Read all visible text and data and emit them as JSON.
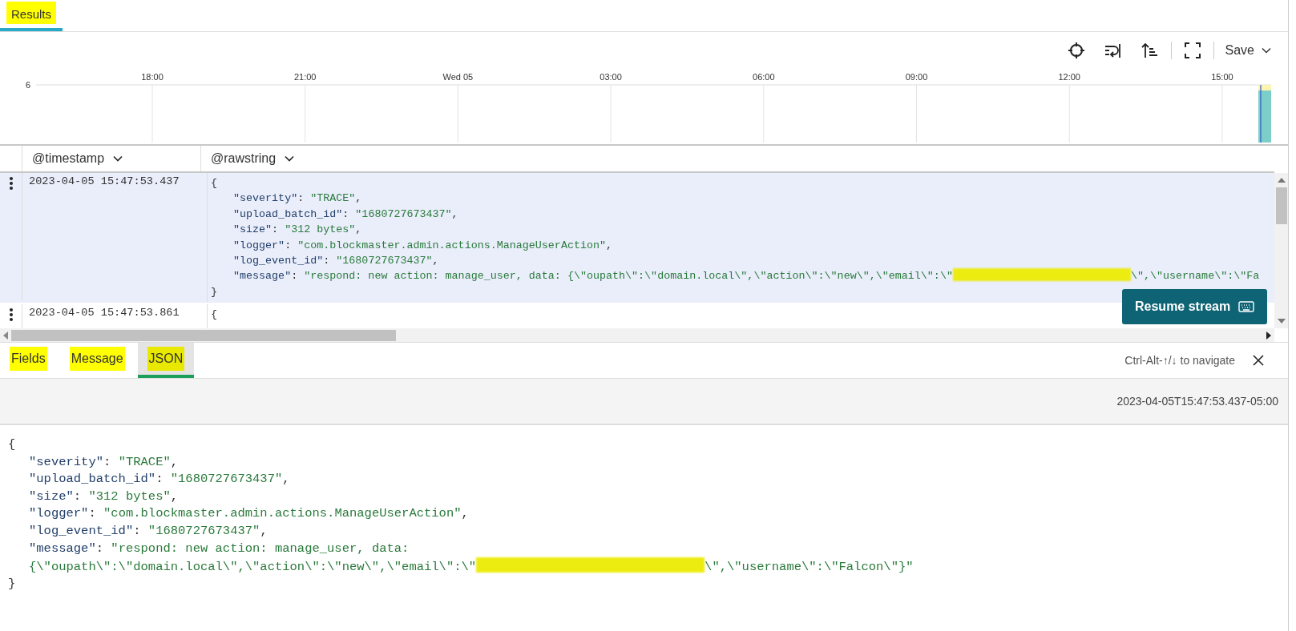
{
  "results_tab": {
    "label": "Results",
    "selected": true,
    "highlighted": true
  },
  "toolbar": {
    "save_label": "Save"
  },
  "histogram": {
    "y_label": "6",
    "x_labels": [
      "18:00",
      "21:00",
      "Wed 05",
      "03:00",
      "06:00",
      "09:00",
      "12:00",
      "15:00"
    ]
  },
  "table": {
    "columns": [
      {
        "label": "@timestamp"
      },
      {
        "label": "@rawstring"
      }
    ],
    "rows": [
      {
        "selected": true,
        "timestamp": "2023-04-05 15:47:53.437",
        "lines": [
          {
            "kind": "brace",
            "segments": [
              {
                "kind": "punct",
                "text": "{"
              }
            ]
          },
          {
            "kind": "field",
            "segments": [
              {
                "kind": "key",
                "text": "\"severity\""
              },
              {
                "kind": "punct",
                "text": ": "
              },
              {
                "kind": "string",
                "text": "\"TRACE\""
              },
              {
                "kind": "punct",
                "text": ","
              }
            ]
          },
          {
            "kind": "field",
            "segments": [
              {
                "kind": "key",
                "text": "\"upload_batch_id\""
              },
              {
                "kind": "punct",
                "text": ": "
              },
              {
                "kind": "string",
                "text": "\"1680727673437\""
              },
              {
                "kind": "punct",
                "text": ","
              }
            ]
          },
          {
            "kind": "field",
            "segments": [
              {
                "kind": "key",
                "text": "\"size\""
              },
              {
                "kind": "punct",
                "text": ": "
              },
              {
                "kind": "string",
                "text": "\"312 bytes\""
              },
              {
                "kind": "punct",
                "text": ","
              }
            ]
          },
          {
            "kind": "field",
            "segments": [
              {
                "kind": "key",
                "text": "\"logger\""
              },
              {
                "kind": "punct",
                "text": ": "
              },
              {
                "kind": "string",
                "text": "\"com.blockmaster.admin.actions.ManageUserAction\""
              },
              {
                "kind": "punct",
                "text": ","
              }
            ]
          },
          {
            "kind": "field",
            "segments": [
              {
                "kind": "key",
                "text": "\"log_event_id\""
              },
              {
                "kind": "punct",
                "text": ": "
              },
              {
                "kind": "string",
                "text": "\"1680727673437\""
              },
              {
                "kind": "punct",
                "text": ","
              }
            ]
          },
          {
            "kind": "field",
            "segments": [
              {
                "kind": "key",
                "text": "\"message\""
              },
              {
                "kind": "punct",
                "text": ": "
              },
              {
                "kind": "string",
                "text": "\"respond: new action: manage_user, data: {\\\"oupath\\\":\\\"domain.local\\\",\\\"action\\\":\\\"new\\\",\\\"email\\\":\\\""
              },
              {
                "kind": "redacted"
              },
              {
                "kind": "string",
                "text": "\\\",\\\"username\\\":\\\"Fa"
              }
            ]
          },
          {
            "kind": "brace",
            "segments": [
              {
                "kind": "punct",
                "text": "}"
              }
            ]
          }
        ]
      },
      {
        "selected": false,
        "timestamp": "2023-04-05 15:47:53.861",
        "lines": [
          {
            "kind": "brace",
            "segments": [
              {
                "kind": "punct",
                "text": "{"
              }
            ]
          }
        ]
      }
    ]
  },
  "resume_button": {
    "label": "Resume stream"
  },
  "detail": {
    "tabs": [
      {
        "label": "Fields",
        "selected": false,
        "highlighted": true
      },
      {
        "label": "Message",
        "selected": false,
        "highlighted": true
      },
      {
        "label": "JSON",
        "selected": true,
        "highlighted": true
      }
    ],
    "hint": "Ctrl-Alt-↑/↓ to navigate",
    "timestamp": "2023-04-05T15:47:53.437-05:00",
    "lines": [
      {
        "kind": "brace",
        "segments": [
          {
            "kind": "punct",
            "text": "{"
          }
        ]
      },
      {
        "kind": "field",
        "segments": [
          {
            "kind": "key",
            "text": "\"severity\""
          },
          {
            "kind": "punct",
            "text": ": "
          },
          {
            "kind": "string",
            "text": "\"TRACE\""
          },
          {
            "kind": "punct",
            "text": ","
          }
        ]
      },
      {
        "kind": "field",
        "segments": [
          {
            "kind": "key",
            "text": "\"upload_batch_id\""
          },
          {
            "kind": "punct",
            "text": ": "
          },
          {
            "kind": "string",
            "text": "\"1680727673437\""
          },
          {
            "kind": "punct",
            "text": ","
          }
        ]
      },
      {
        "kind": "field",
        "segments": [
          {
            "kind": "key",
            "text": "\"size\""
          },
          {
            "kind": "punct",
            "text": ": "
          },
          {
            "kind": "string",
            "text": "\"312 bytes\""
          },
          {
            "kind": "punct",
            "text": ","
          }
        ]
      },
      {
        "kind": "field",
        "segments": [
          {
            "kind": "key",
            "text": "\"logger\""
          },
          {
            "kind": "punct",
            "text": ": "
          },
          {
            "kind": "string",
            "text": "\"com.blockmaster.admin.actions.ManageUserAction\""
          },
          {
            "kind": "punct",
            "text": ","
          }
        ]
      },
      {
        "kind": "field",
        "segments": [
          {
            "kind": "key",
            "text": "\"log_event_id\""
          },
          {
            "kind": "punct",
            "text": ": "
          },
          {
            "kind": "string",
            "text": "\"1680727673437\""
          },
          {
            "kind": "punct",
            "text": ","
          }
        ]
      },
      {
        "kind": "field",
        "segments": [
          {
            "kind": "key",
            "text": "\"message\""
          },
          {
            "kind": "punct",
            "text": ": "
          },
          {
            "kind": "string",
            "text": "\"respond: new action: manage_user, data:"
          }
        ]
      },
      {
        "kind": "field",
        "segments": [
          {
            "kind": "string",
            "text": "{\\\"oupath\\\":\\\"domain.local\\\",\\\"action\\\":\\\"new\\\",\\\"email\\\":\\\""
          },
          {
            "kind": "redacted"
          },
          {
            "kind": "string",
            "text": "\\\",\\\"username\\\":\\\"Falcon\\\"}\""
          }
        ]
      },
      {
        "kind": "brace",
        "segments": [
          {
            "kind": "punct",
            "text": "}"
          }
        ]
      }
    ]
  }
}
